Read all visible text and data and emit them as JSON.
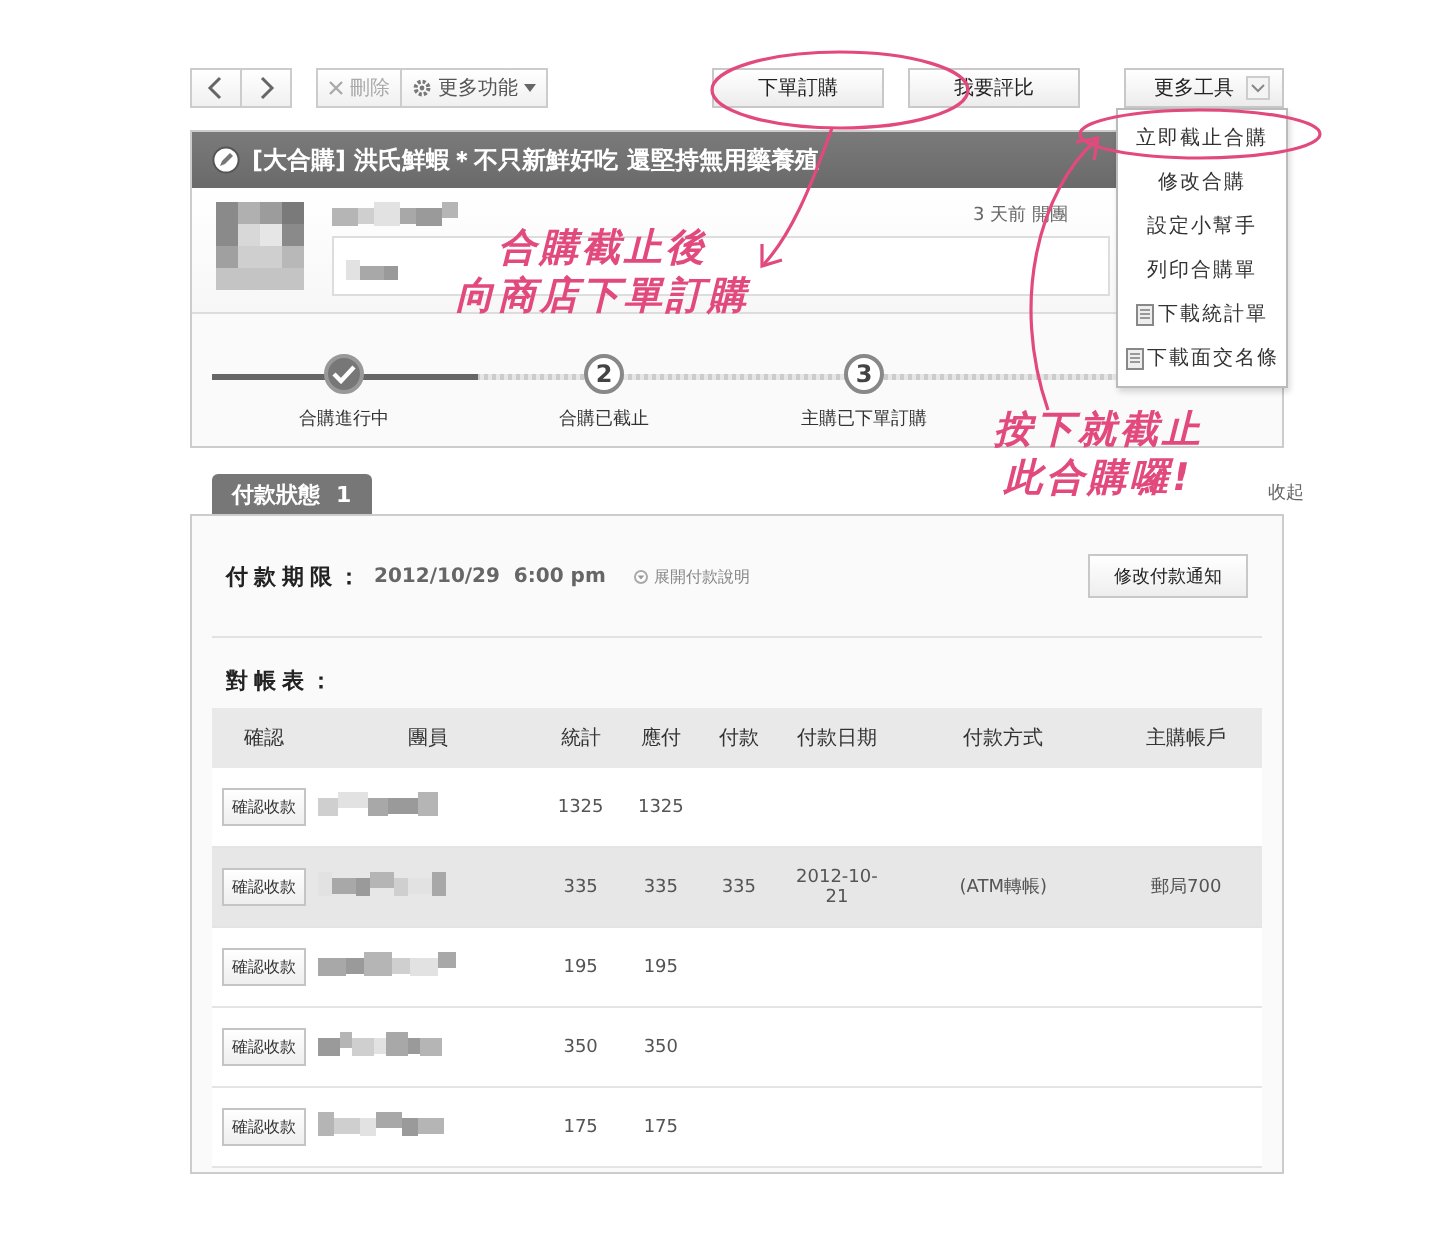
{
  "toolbar": {
    "delete": {
      "label": "刪除",
      "disabled": true
    },
    "more_functions": "更多功能",
    "buttons": [
      {
        "label": "下單訂購"
      },
      {
        "label": "我要評比"
      }
    ],
    "more_tools": "更多工具"
  },
  "menu": [
    {
      "label": "立即截止合購",
      "kind": "plain"
    },
    {
      "label": "修改合購",
      "kind": "plain"
    },
    {
      "label": "設定小幫手",
      "kind": "plain"
    },
    {
      "label": "列印合購單",
      "kind": "plain"
    },
    {
      "label": "下載統計單",
      "kind": "file"
    },
    {
      "label": "下載面交名條",
      "kind": "file"
    }
  ],
  "deal": {
    "title": "[大合購] 洪氏鮮蝦＊不只新鮮好吃 還堅持無用藥養殖",
    "posted": "3 天前 開團",
    "steps": [
      {
        "label": "合購進行中",
        "done": true
      },
      {
        "label": "合購已截止",
        "number": "2",
        "done": false
      },
      {
        "label": "主購已下單訂購",
        "number": "3",
        "done": false
      }
    ]
  },
  "tab": {
    "label": "付款狀態",
    "count": "1",
    "selected": true
  },
  "collapse_link": "收起",
  "payment": {
    "deadline_label": "付款期限：",
    "deadline": "2012/10/29  6:00 pm",
    "expand_link": "展開付款說明",
    "edit_button": "修改付款通知"
  },
  "table": {
    "title": "對帳表：",
    "columns": [
      "確認",
      "團員",
      "統計",
      "應付",
      "付款",
      "付款日期",
      "付款方式",
      "主購帳戶"
    ],
    "rows": [
      {
        "action": "確認收款",
        "total": "1325",
        "due": "1325",
        "highlighted": false
      },
      {
        "action": "確認收款",
        "total": "335",
        "due": "335",
        "paid": "335",
        "date": "2012-10-21",
        "method": "(ATM轉帳)",
        "account": "郵局700",
        "highlighted": true
      },
      {
        "action": "確認收款",
        "total": "195",
        "due": "195",
        "highlighted": false
      },
      {
        "action": "確認收款",
        "total": "350",
        "due": "350",
        "highlighted": false
      },
      {
        "action": "確認收款",
        "total": "175",
        "due": "175",
        "highlighted": false
      }
    ]
  },
  "annotations": [
    {
      "lines": [
        "合購截止後",
        "向商店下單訂購"
      ]
    },
    {
      "lines": [
        "按下就截止",
        "此合購囉!"
      ]
    }
  ]
}
